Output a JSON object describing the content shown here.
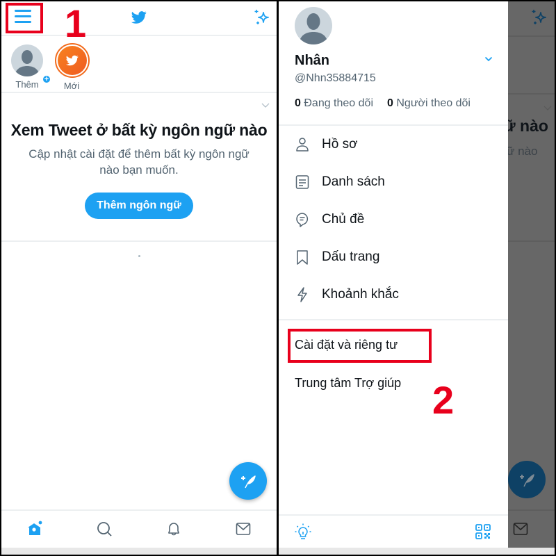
{
  "left": {
    "header": {
      "menu_icon": "hamburger-menu-icon",
      "logo_icon": "twitter-bird-icon",
      "sparkle_icon": "sparkle-icon"
    },
    "fleets": [
      {
        "label": "Thêm",
        "icon": "default-avatar-with-plus"
      },
      {
        "label": "Mới",
        "icon": "twitter-orange-avatar"
      }
    ],
    "language_card": {
      "title": "Xem Tweet ở bất kỳ ngôn ngữ nào",
      "subtitle": "Cập nhật cài đặt để thêm bất kỳ ngôn ngữ nào bạn muốn.",
      "button_label": "Thêm ngôn ngữ"
    },
    "fab_icon": "compose-tweet-icon",
    "bottom_nav": [
      "home-icon",
      "search-icon",
      "notifications-bell-icon",
      "messages-envelope-icon"
    ],
    "annotation_number": "1"
  },
  "right": {
    "profile": {
      "name": "Nhân",
      "handle": "@Nhn35884715",
      "following_count": "0",
      "following_label": "Đang theo dõi",
      "followers_count": "0",
      "followers_label": "Người theo dõi"
    },
    "menu": [
      {
        "label": "Hồ sơ",
        "icon": "profile-person-icon"
      },
      {
        "label": "Danh sách",
        "icon": "lists-icon"
      },
      {
        "label": "Chủ đề",
        "icon": "topics-icon"
      },
      {
        "label": "Dấu trang",
        "icon": "bookmark-icon"
      },
      {
        "label": "Khoảnh khắc",
        "icon": "moments-lightning-icon"
      }
    ],
    "settings_label": "Cài đặt và riêng tư",
    "help_label": "Trung tâm Trợ giúp",
    "bottom_icons": [
      "lightbulb-icon",
      "qr-code-icon"
    ],
    "background_title_fragment": "ữ nào",
    "background_sub_fragment": "ữ nào",
    "annotation_number": "2"
  },
  "colors": {
    "brand_blue": "#1da1f2",
    "annotation_red": "#e8001c",
    "text_primary": "#0f1419",
    "text_secondary": "#536471",
    "overlay": "#676767"
  }
}
